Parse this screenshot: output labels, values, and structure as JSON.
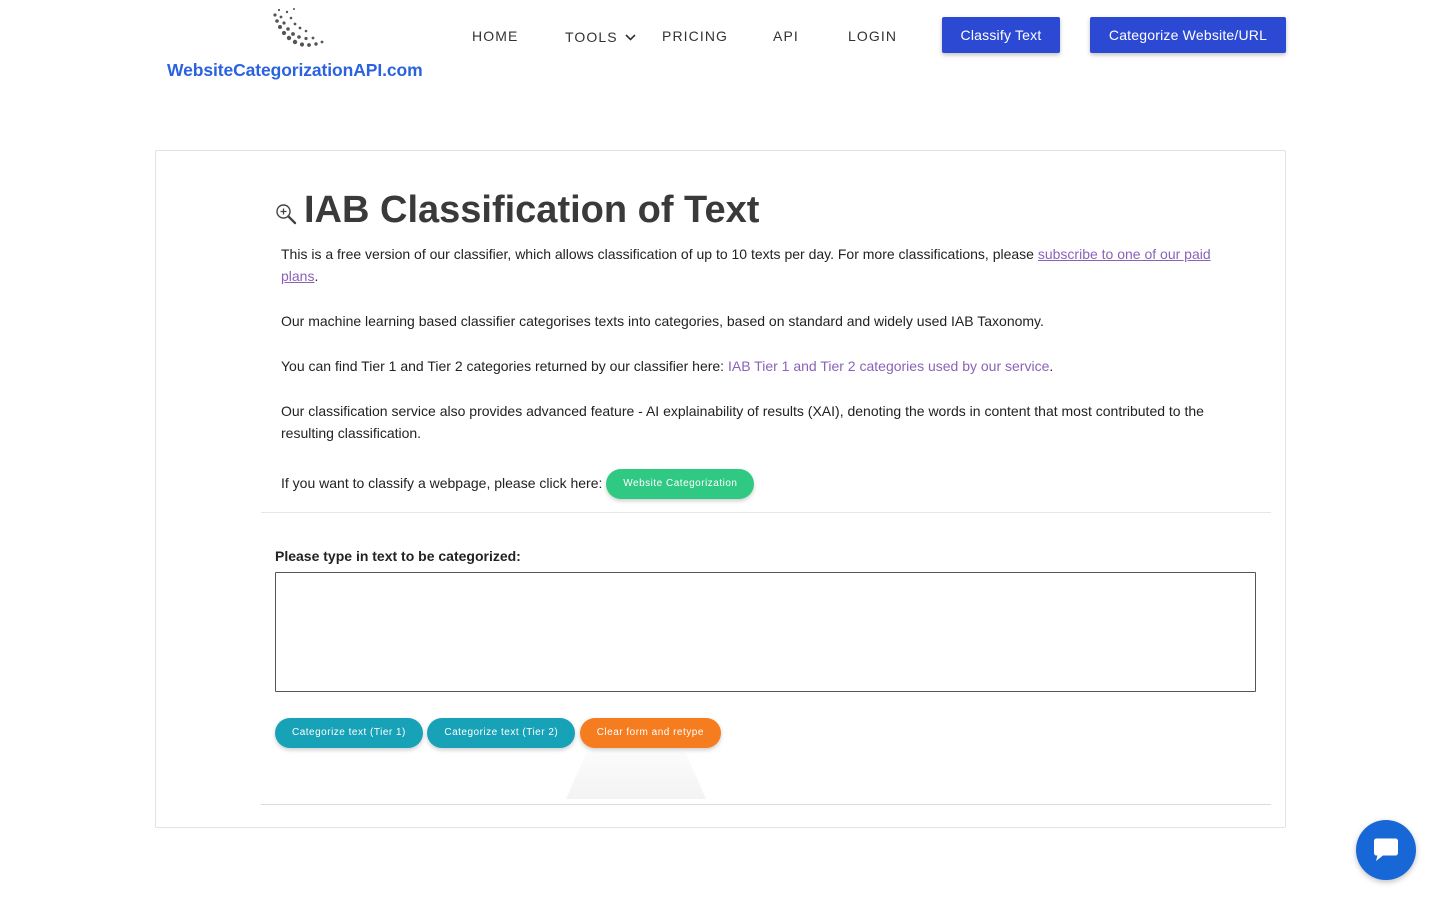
{
  "header": {
    "logo_text": "WebsiteCategorizationAPI.com",
    "nav": [
      {
        "label": "HOME"
      },
      {
        "label": "TOOLS"
      },
      {
        "label": "PRICING"
      },
      {
        "label": "API"
      },
      {
        "label": "LOGIN"
      }
    ],
    "btn_classify": "Classify Text",
    "btn_categorize": "Categorize Website/URL"
  },
  "main": {
    "title": "IAB Classification of Text",
    "p1_text": "This is a free version of our classifier, which allows classification of up to 10 texts per day. For more classifications, please ",
    "p1_link": "subscribe to one of our paid plans",
    "p1_end": ".",
    "p2": "Our machine learning based classifier categorises texts into categories, based on standard and widely used IAB Taxonomy.",
    "p3_text": "You can find Tier 1 and Tier 2 categories returned by our classifier here: ",
    "p3_link": "IAB Tier 1 and Tier 2 categories used by our service",
    "p3_end": ".",
    "p4": "Our classification service also provides advanced feature - AI explainability of results (XAI), denoting the words in content that most contributed to the resulting classification.",
    "p5_text": "If you want to classify a webpage, please click here: ",
    "p5_button": "Website Categorization",
    "form_label": "Please type in text to be categorized:",
    "textarea_value": "",
    "btn_tier1": "Categorize text (Tier 1)",
    "btn_tier2": "Categorize text (Tier 2)",
    "btn_clear": "Clear form and retype"
  },
  "colors": {
    "brand_blue": "#2c49d3",
    "logo_blue": "#2a62e0",
    "green": "#2fc984",
    "teal": "#17a2b8",
    "orange": "#f57c1f",
    "link_purple": "#8a63b8",
    "chat_blue": "#1867d6"
  }
}
